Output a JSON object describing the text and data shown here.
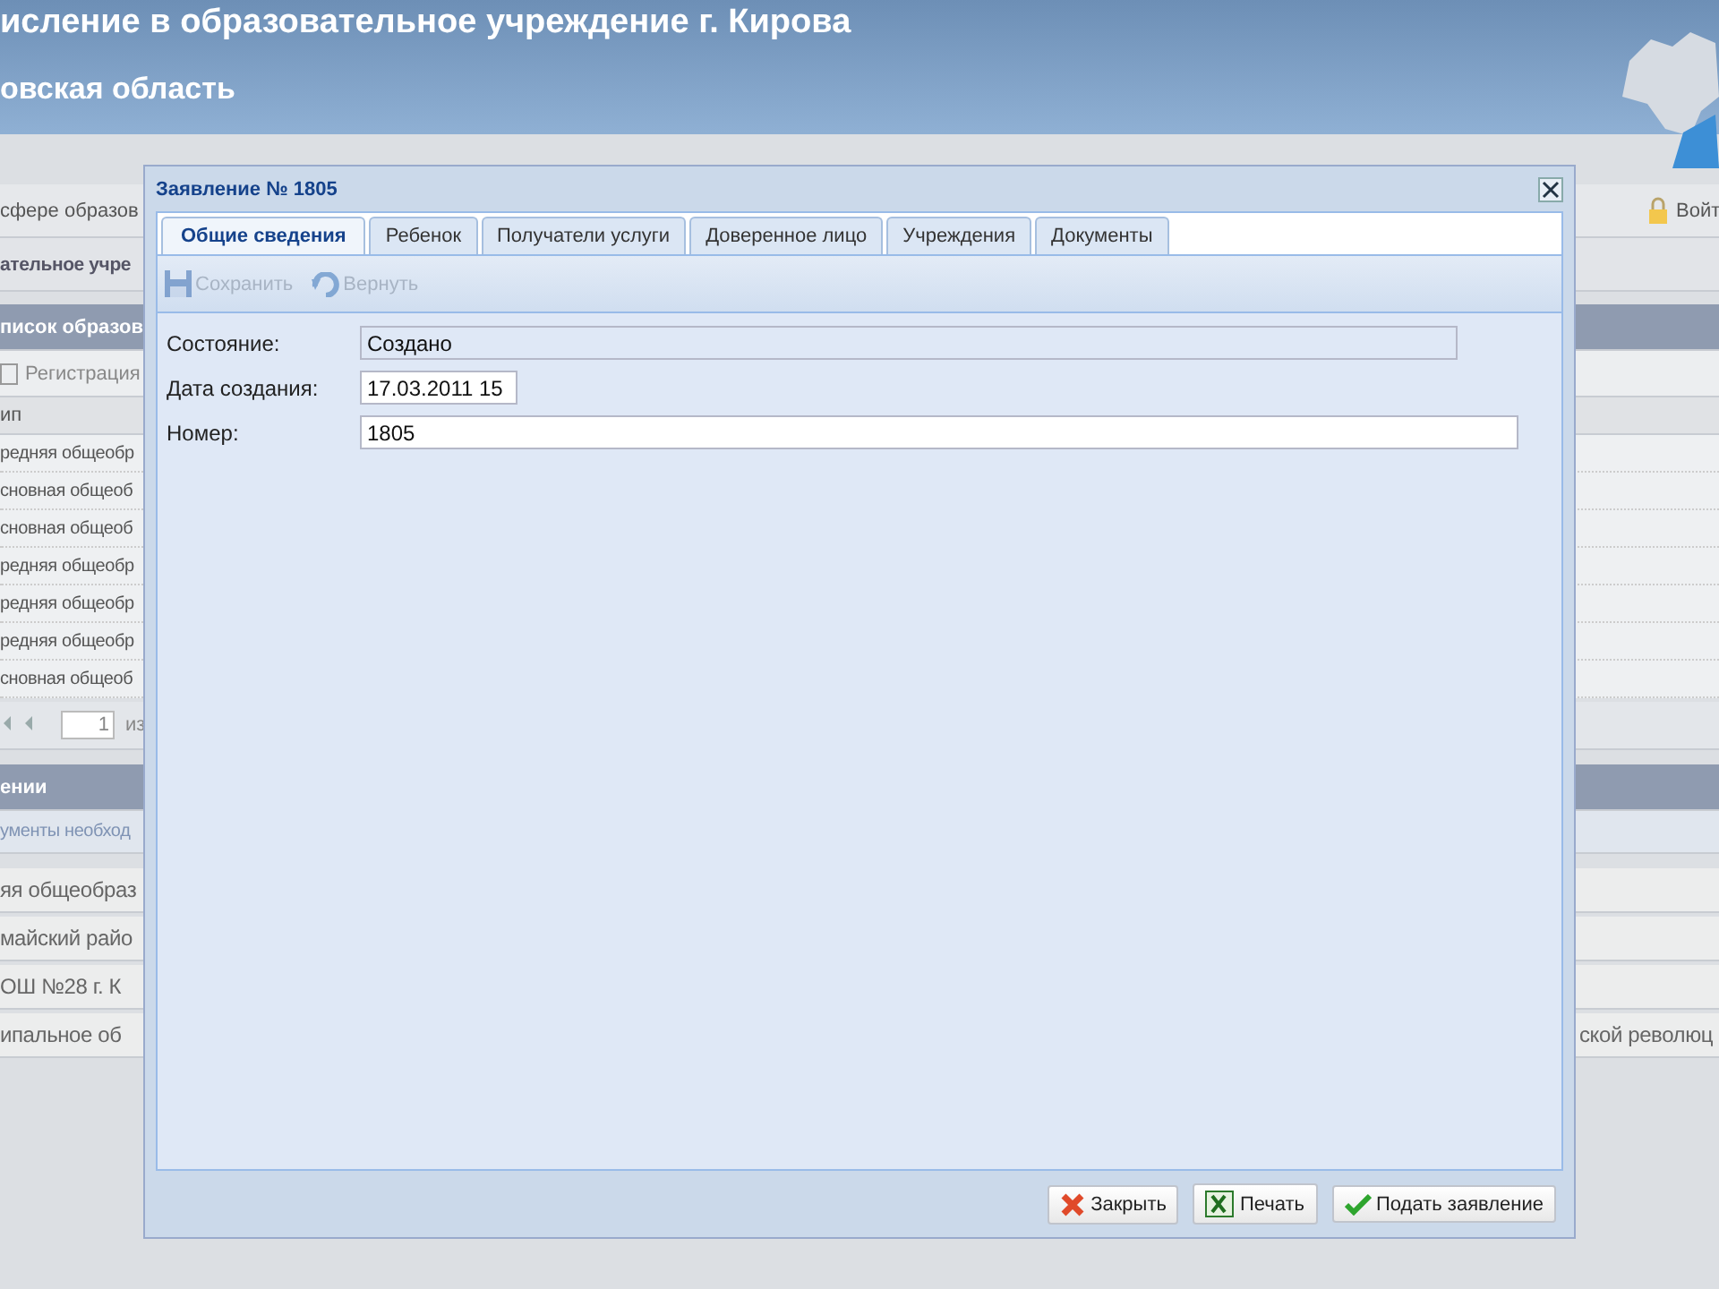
{
  "header": {
    "title": "исление в образовательное учреждение г. Кирова",
    "subtitle": "овская область"
  },
  "rows": [
    {
      "kind": "nav",
      "text": "сфере образов",
      "right": "Войт"
    },
    {
      "kind": "title",
      "text": "ательное учре"
    },
    {
      "kind": "header",
      "text": "писок образов"
    },
    {
      "kind": "check",
      "text": "Регистрация"
    },
    {
      "kind": "colhead",
      "text": "ип"
    },
    {
      "kind": "cell",
      "text": "редняя общеобр"
    },
    {
      "kind": "cell",
      "text": "сновная общеоб"
    },
    {
      "kind": "cell",
      "text": "сновная общеоб"
    },
    {
      "kind": "cell",
      "text": "редняя общеобр"
    },
    {
      "kind": "cell",
      "text": "редняя общеобр"
    },
    {
      "kind": "cell",
      "text": "редняя общеобр"
    },
    {
      "kind": "cell",
      "text": "сновная общеоб"
    },
    {
      "kind": "pager",
      "page": "1",
      "text": "из"
    },
    {
      "kind": "header",
      "text": "ении"
    },
    {
      "kind": "link",
      "text": "ументы необход"
    },
    {
      "kind": "big",
      "text": "яя общеобраз"
    },
    {
      "kind": "big",
      "text": "майский райо"
    },
    {
      "kind": "big",
      "text": "ОШ №28 г. К"
    },
    {
      "kind": "big",
      "text": "ипальное об",
      "right": "ской революц"
    }
  ],
  "dialog": {
    "title": "Заявление № 1805",
    "tabs": [
      {
        "label": "Общие сведения",
        "selected": true
      },
      {
        "label": "Ребенок",
        "selected": false
      },
      {
        "label": "Получатели услуги",
        "selected": false
      },
      {
        "label": "Доверенное лицо",
        "selected": false
      },
      {
        "label": "Учреждения",
        "selected": false
      },
      {
        "label": "Документы",
        "selected": false
      }
    ],
    "toolbar": [
      {
        "kind": "save",
        "label": "Сохранить",
        "disabled": true
      },
      {
        "kind": "revert",
        "label": "Вернуть",
        "disabled": true
      }
    ],
    "fields": [
      {
        "kind": "status",
        "label": "Состояние:",
        "value": "Создано"
      },
      {
        "kind": "date",
        "label": "Дата создания:",
        "value": "17.03.2011 15"
      },
      {
        "kind": "number",
        "label": "Номер:",
        "value": "1805"
      }
    ],
    "buttons": [
      {
        "kind": "close",
        "label": "Закрыть"
      },
      {
        "kind": "print",
        "label": "Печать"
      },
      {
        "kind": "submit",
        "label": "Подать заявление"
      }
    ]
  }
}
